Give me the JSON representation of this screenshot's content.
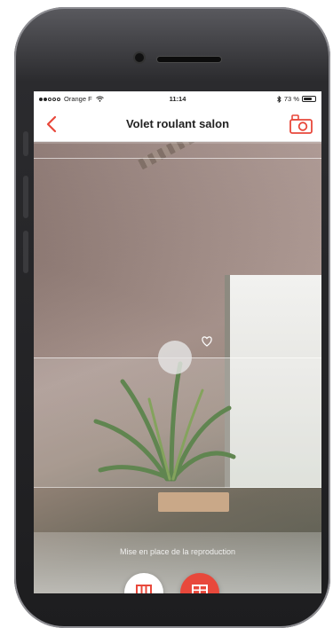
{
  "status_bar": {
    "carrier": "Orange F",
    "time": "11:14",
    "battery_text": "73 %",
    "battery_level": 0.73
  },
  "nav": {
    "title": "Volet roulant salon"
  },
  "shutter_control": {
    "handle_label": "",
    "hint_text": "Mise en place de la reproduction"
  },
  "actions": {
    "open_label": "",
    "close_label": ""
  },
  "colors": {
    "accent": "#e8483b",
    "text": "#222222"
  }
}
